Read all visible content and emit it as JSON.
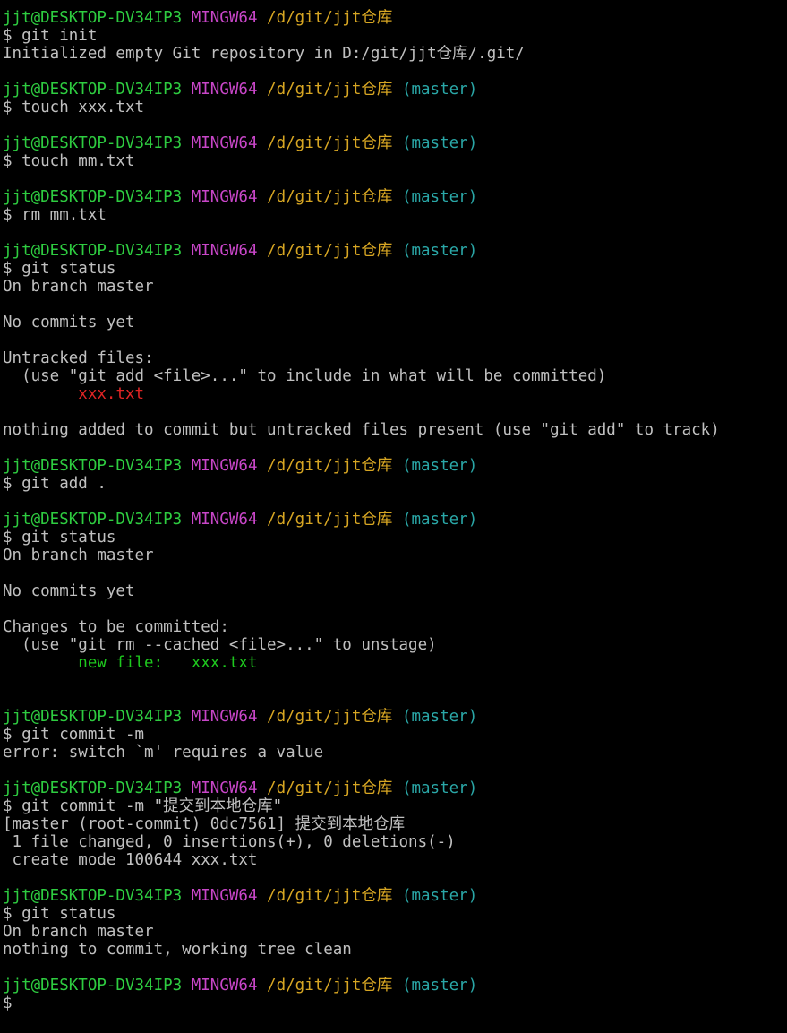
{
  "terminal": {
    "colors": {
      "user_host": "#2ecc40",
      "shell": "#c846c8",
      "path": "#d7a623",
      "branch": "#2aa7a7",
      "output": "#c0c0c0",
      "untracked": "#e02424",
      "staged": "#1ec81e",
      "background": "#000000"
    },
    "lines": [
      {
        "kind": "prompt",
        "segs": [
          {
            "t": "jjt@DESKTOP-DV34IP3",
            "c": "user"
          },
          {
            "t": " "
          },
          {
            "t": "MINGW64",
            "c": "host"
          },
          {
            "t": " "
          },
          {
            "t": "/d/git/jjt仓库",
            "c": "path"
          }
        ]
      },
      {
        "kind": "command",
        "segs": [
          {
            "t": "$ git init"
          }
        ]
      },
      {
        "kind": "output",
        "segs": [
          {
            "t": "Initialized empty Git repository in D:/git/jjt仓库/.git/"
          }
        ]
      },
      {
        "kind": "blank",
        "segs": []
      },
      {
        "kind": "prompt",
        "segs": [
          {
            "t": "jjt@DESKTOP-DV34IP3",
            "c": "user"
          },
          {
            "t": " "
          },
          {
            "t": "MINGW64",
            "c": "host"
          },
          {
            "t": " "
          },
          {
            "t": "/d/git/jjt仓库",
            "c": "path"
          },
          {
            "t": " "
          },
          {
            "t": "(master)",
            "c": "branch"
          }
        ]
      },
      {
        "kind": "command",
        "segs": [
          {
            "t": "$ touch xxx.txt"
          }
        ]
      },
      {
        "kind": "blank",
        "segs": []
      },
      {
        "kind": "prompt",
        "segs": [
          {
            "t": "jjt@DESKTOP-DV34IP3",
            "c": "user"
          },
          {
            "t": " "
          },
          {
            "t": "MINGW64",
            "c": "host"
          },
          {
            "t": " "
          },
          {
            "t": "/d/git/jjt仓库",
            "c": "path"
          },
          {
            "t": " "
          },
          {
            "t": "(master)",
            "c": "branch"
          }
        ]
      },
      {
        "kind": "command",
        "segs": [
          {
            "t": "$ touch mm.txt"
          }
        ]
      },
      {
        "kind": "blank",
        "segs": []
      },
      {
        "kind": "prompt",
        "segs": [
          {
            "t": "jjt@DESKTOP-DV34IP3",
            "c": "user"
          },
          {
            "t": " "
          },
          {
            "t": "MINGW64",
            "c": "host"
          },
          {
            "t": " "
          },
          {
            "t": "/d/git/jjt仓库",
            "c": "path"
          },
          {
            "t": " "
          },
          {
            "t": "(master)",
            "c": "branch"
          }
        ]
      },
      {
        "kind": "command",
        "segs": [
          {
            "t": "$ rm mm.txt"
          }
        ]
      },
      {
        "kind": "blank",
        "segs": []
      },
      {
        "kind": "prompt",
        "segs": [
          {
            "t": "jjt@DESKTOP-DV34IP3",
            "c": "user"
          },
          {
            "t": " "
          },
          {
            "t": "MINGW64",
            "c": "host"
          },
          {
            "t": " "
          },
          {
            "t": "/d/git/jjt仓库",
            "c": "path"
          },
          {
            "t": " "
          },
          {
            "t": "(master)",
            "c": "branch"
          }
        ]
      },
      {
        "kind": "command",
        "segs": [
          {
            "t": "$ git status"
          }
        ]
      },
      {
        "kind": "output",
        "segs": [
          {
            "t": "On branch master"
          }
        ]
      },
      {
        "kind": "blank",
        "segs": []
      },
      {
        "kind": "output",
        "segs": [
          {
            "t": "No commits yet"
          }
        ]
      },
      {
        "kind": "blank",
        "segs": []
      },
      {
        "kind": "output",
        "segs": [
          {
            "t": "Untracked files:"
          }
        ]
      },
      {
        "kind": "output",
        "segs": [
          {
            "t": "  (use \"git add <file>...\" to include in what will be committed)"
          }
        ]
      },
      {
        "kind": "output",
        "segs": [
          {
            "t": "        "
          },
          {
            "t": "xxx.txt",
            "c": "red"
          }
        ]
      },
      {
        "kind": "blank",
        "segs": []
      },
      {
        "kind": "output",
        "segs": [
          {
            "t": "nothing added to commit but untracked files present (use \"git add\" to track)"
          }
        ]
      },
      {
        "kind": "blank",
        "segs": []
      },
      {
        "kind": "prompt",
        "segs": [
          {
            "t": "jjt@DESKTOP-DV34IP3",
            "c": "user"
          },
          {
            "t": " "
          },
          {
            "t": "MINGW64",
            "c": "host"
          },
          {
            "t": " "
          },
          {
            "t": "/d/git/jjt仓库",
            "c": "path"
          },
          {
            "t": " "
          },
          {
            "t": "(master)",
            "c": "branch"
          }
        ]
      },
      {
        "kind": "command",
        "segs": [
          {
            "t": "$ git add ."
          }
        ]
      },
      {
        "kind": "blank",
        "segs": []
      },
      {
        "kind": "prompt",
        "segs": [
          {
            "t": "jjt@DESKTOP-DV34IP3",
            "c": "user"
          },
          {
            "t": " "
          },
          {
            "t": "MINGW64",
            "c": "host"
          },
          {
            "t": " "
          },
          {
            "t": "/d/git/jjt仓库",
            "c": "path"
          },
          {
            "t": " "
          },
          {
            "t": "(master)",
            "c": "branch"
          }
        ]
      },
      {
        "kind": "command",
        "segs": [
          {
            "t": "$ git status"
          }
        ]
      },
      {
        "kind": "output",
        "segs": [
          {
            "t": "On branch master"
          }
        ]
      },
      {
        "kind": "blank",
        "segs": []
      },
      {
        "kind": "output",
        "segs": [
          {
            "t": "No commits yet"
          }
        ]
      },
      {
        "kind": "blank",
        "segs": []
      },
      {
        "kind": "output",
        "segs": [
          {
            "t": "Changes to be committed:"
          }
        ]
      },
      {
        "kind": "output",
        "segs": [
          {
            "t": "  (use \"git rm --cached <file>...\" to unstage)"
          }
        ]
      },
      {
        "kind": "output",
        "segs": [
          {
            "t": "        "
          },
          {
            "t": "new file:   xxx.txt",
            "c": "green"
          }
        ]
      },
      {
        "kind": "blank",
        "segs": []
      },
      {
        "kind": "blank",
        "segs": []
      },
      {
        "kind": "prompt",
        "segs": [
          {
            "t": "jjt@DESKTOP-DV34IP3",
            "c": "user"
          },
          {
            "t": " "
          },
          {
            "t": "MINGW64",
            "c": "host"
          },
          {
            "t": " "
          },
          {
            "t": "/d/git/jjt仓库",
            "c": "path"
          },
          {
            "t": " "
          },
          {
            "t": "(master)",
            "c": "branch"
          }
        ]
      },
      {
        "kind": "command",
        "segs": [
          {
            "t": "$ git commit -m"
          }
        ]
      },
      {
        "kind": "output",
        "segs": [
          {
            "t": "error: switch `m' requires a value"
          }
        ]
      },
      {
        "kind": "blank",
        "segs": []
      },
      {
        "kind": "prompt",
        "segs": [
          {
            "t": "jjt@DESKTOP-DV34IP3",
            "c": "user"
          },
          {
            "t": " "
          },
          {
            "t": "MINGW64",
            "c": "host"
          },
          {
            "t": " "
          },
          {
            "t": "/d/git/jjt仓库",
            "c": "path"
          },
          {
            "t": " "
          },
          {
            "t": "(master)",
            "c": "branch"
          }
        ]
      },
      {
        "kind": "command",
        "segs": [
          {
            "t": "$ git commit -m \"提交到本地仓库\""
          }
        ]
      },
      {
        "kind": "output",
        "segs": [
          {
            "t": "[master (root-commit) 0dc7561] 提交到本地仓库"
          }
        ]
      },
      {
        "kind": "output",
        "segs": [
          {
            "t": " 1 file changed, 0 insertions(+), 0 deletions(-)"
          }
        ]
      },
      {
        "kind": "output",
        "segs": [
          {
            "t": " create mode 100644 xxx.txt"
          }
        ]
      },
      {
        "kind": "blank",
        "segs": []
      },
      {
        "kind": "prompt",
        "segs": [
          {
            "t": "jjt@DESKTOP-DV34IP3",
            "c": "user"
          },
          {
            "t": " "
          },
          {
            "t": "MINGW64",
            "c": "host"
          },
          {
            "t": " "
          },
          {
            "t": "/d/git/jjt仓库",
            "c": "path"
          },
          {
            "t": " "
          },
          {
            "t": "(master)",
            "c": "branch"
          }
        ]
      },
      {
        "kind": "command",
        "segs": [
          {
            "t": "$ git status"
          }
        ]
      },
      {
        "kind": "output",
        "segs": [
          {
            "t": "On branch master"
          }
        ]
      },
      {
        "kind": "output",
        "segs": [
          {
            "t": "nothing to commit, working tree clean"
          }
        ]
      },
      {
        "kind": "blank",
        "segs": []
      },
      {
        "kind": "prompt",
        "segs": [
          {
            "t": "jjt@DESKTOP-DV34IP3",
            "c": "user"
          },
          {
            "t": " "
          },
          {
            "t": "MINGW64",
            "c": "host"
          },
          {
            "t": " "
          },
          {
            "t": "/d/git/jjt仓库",
            "c": "path"
          },
          {
            "t": " "
          },
          {
            "t": "(master)",
            "c": "branch"
          }
        ]
      },
      {
        "kind": "input",
        "segs": [
          {
            "t": "$ "
          }
        ]
      }
    ]
  }
}
